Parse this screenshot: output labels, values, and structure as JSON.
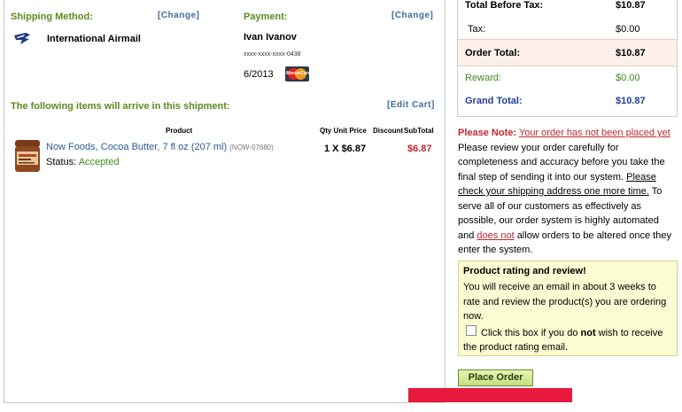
{
  "shipping": {
    "heading": "Shipping Method:",
    "change_label": "[Change]",
    "method": "International Airmail",
    "carrier_icon": "usps-eagle-icon"
  },
  "payment": {
    "heading": "Payment:",
    "change_label": "[Change]",
    "name": "Ivan Ivanov",
    "card_number": "xxxx-xxxx-xxxx-0438",
    "expiry": "6/2013",
    "card_logo_text": "MasterCard",
    "card_icon": "mastercard-icon"
  },
  "shipment": {
    "heading": "The following items will arrive in this shipment:",
    "edit_cart_label": "[Edit Cart]",
    "columns": {
      "product": "Product",
      "qty_unit_price": "Qty Unit Price",
      "discount": "Discount",
      "subtotal": "SubTotal"
    },
    "items": [
      {
        "name": "Now Foods, Cocoa Butter, 7 fl oz (207 ml)",
        "sku": "(NOW-07680)",
        "status_label": "Status:",
        "status": "Accepted",
        "qty_price": "1 X $6.87",
        "subtotal": "$6.87"
      }
    ]
  },
  "totals": {
    "before_tax_label": "Total Before Tax:",
    "before_tax": "$10.87",
    "tax_label": "Tax:",
    "tax": "$0.00",
    "order_total_label": "Order Total:",
    "order_total": "$10.87",
    "reward_label": "Reward:",
    "reward": "$0.00",
    "grand_total_label": "Grand Total:",
    "grand_total": "$10.87"
  },
  "note": {
    "label": "Please Note:",
    "warning_link": "Your order has not been placed yet",
    "text1": "Please review your order carefully for completeness and accuracy before you take the final step of sending it into our system.",
    "address_link": "Please check your shipping address one more time.",
    "text2": "To serve all of our customers as effectively as possible, our order system is highly automated and",
    "does_not": "does not",
    "text3": "allow orders to be altered once they enter the system."
  },
  "rating": {
    "title": "Product rating and review!",
    "text": "You will receive an email in about 3 weeks to rate and review the product(s) you are ordering now.",
    "opt_part1": "Click this box if you do",
    "opt_not": "not",
    "opt_part2": "wish to receive the product rating email."
  },
  "place_order_label": "Place Order",
  "colors": {
    "heading_green": "#5b8a1e",
    "link_blue": "#3a6ea5",
    "price_red": "#c0272d",
    "grand_total_blue": "#1e3f9a",
    "reward_green": "#3d8a1e",
    "rating_bg": "#fcfcd2",
    "red_bar": "#e8193c"
  }
}
